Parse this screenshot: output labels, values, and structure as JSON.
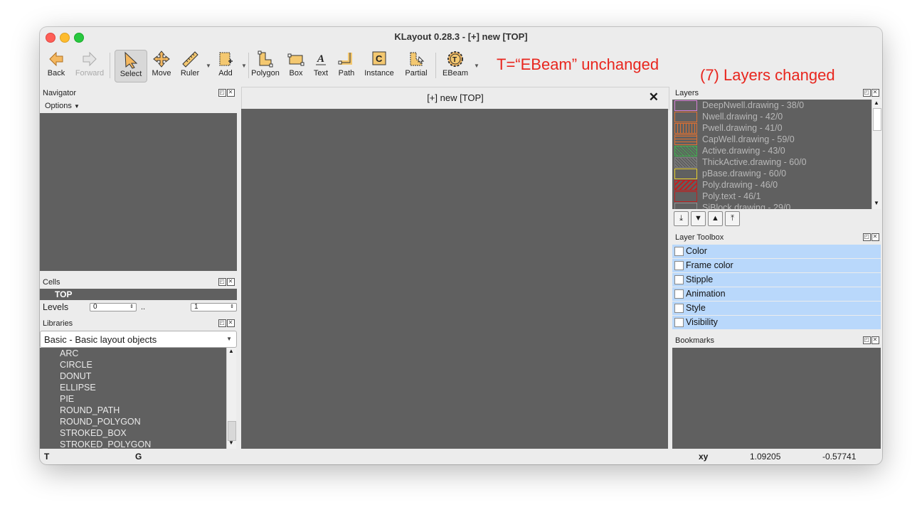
{
  "window": {
    "title": "KLayout 0.28.3 - [+] new [TOP]"
  },
  "toolbar": {
    "back": "Back",
    "forward": "Forward",
    "select": "Select",
    "move": "Move",
    "ruler": "Ruler",
    "add": "Add",
    "polygon": "Polygon",
    "box": "Box",
    "text": "Text",
    "path": "Path",
    "instance": "Instance",
    "partial": "Partial",
    "ebeam": "EBeam"
  },
  "annotations": {
    "ebeam_note": "T=“EBeam” unchanged",
    "layers_note": "(7) Layers changed"
  },
  "navigator": {
    "title": "Navigator",
    "options": "Options"
  },
  "cells": {
    "title": "Cells",
    "top": "TOP",
    "levels_label": "Levels",
    "level_from": "0",
    "level_sep": "..",
    "level_to": "1"
  },
  "libraries": {
    "title": "Libraries",
    "selected": "Basic - Basic layout objects",
    "items": [
      "ARC",
      "CIRCLE",
      "DONUT",
      "ELLIPSE",
      "PIE",
      "ROUND_PATH",
      "ROUND_POLYGON",
      "STROKED_BOX",
      "STROKED_POLYGON"
    ]
  },
  "canvas": {
    "tab_title": "[+] new [TOP]"
  },
  "layers": {
    "title": "Layers",
    "items": [
      {
        "name": "DeepNwell.drawing - 38/0",
        "color": "#d580d5"
      },
      {
        "name": "Nwell.drawing - 42/0",
        "color": "#e07030"
      },
      {
        "name": "Pwell.drawing - 41/0",
        "color": "#e07030"
      },
      {
        "name": "CapWell.drawing - 59/0",
        "color": "#e07030"
      },
      {
        "name": "Active.drawing - 43/0",
        "color": "#40b050"
      },
      {
        "name": "ThickActive.drawing - 60/0",
        "color": "#808080"
      },
      {
        "name": "pBase.drawing - 60/0",
        "color": "#e8d030"
      },
      {
        "name": "Poly.drawing - 46/0",
        "color": "#c02020"
      },
      {
        "name": "Poly.text - 46/1",
        "color": "#c02020"
      },
      {
        "name": "SiBlock.drawing - 29/0",
        "color": "#909090"
      }
    ]
  },
  "layer_toolbox": {
    "title": "Layer Toolbox",
    "items": [
      "Color",
      "Frame color",
      "Stipple",
      "Animation",
      "Style",
      "Visibility"
    ]
  },
  "bookmarks": {
    "title": "Bookmarks"
  },
  "status": {
    "t": "T",
    "g": "G",
    "xy_label": "xy",
    "x": "1.09205",
    "y": "-0.57741"
  }
}
